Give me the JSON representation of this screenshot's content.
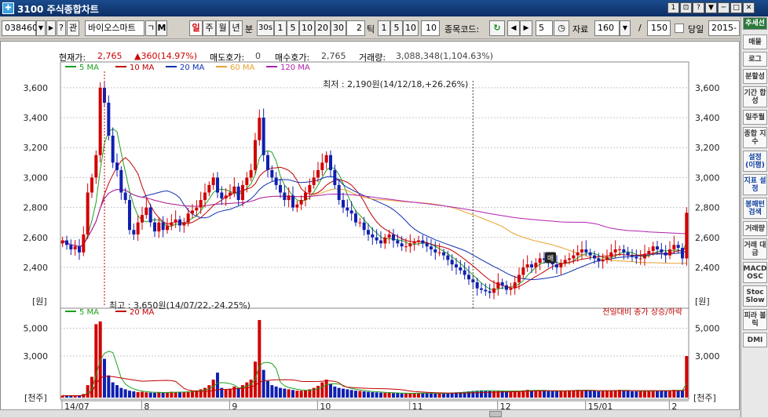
{
  "window": {
    "title": "3100 주식종합차트",
    "controls": [
      "1",
      "⊡",
      "?",
      "▼",
      "─",
      "□",
      "✕"
    ]
  },
  "toolbar": {
    "code": "038460",
    "name": "바이오스마트",
    "name_btn1": "ㄱ",
    "name_btn2": "M",
    "prev_btn": "◀",
    "next_btn": "▶",
    "help_btn": "?",
    "rel_btn": "관",
    "period_day": "일",
    "period_week": "주",
    "period_month": "월",
    "period_year": "년",
    "period_min": "분",
    "min_30s": "30s",
    "min_1": "1",
    "min_5": "5",
    "min_10": "10",
    "min_20": "20",
    "min_30": "30",
    "tick_value": "2",
    "tick_label": "틱",
    "tick_1": "1",
    "tick_5": "5",
    "tick_10": "10",
    "tick_input": "10",
    "stock_code_label": "종목코드:",
    "count_value": "5",
    "data_label": "자료",
    "data_count": "160",
    "slash": "/",
    "total_count": "150",
    "today_label": "당일",
    "date_value": "2015-0"
  },
  "info": {
    "price_label": "현재가:",
    "price": "2,765",
    "change": "▲360(14.97%)",
    "ask_label": "매도호가:",
    "ask": "0",
    "bid_label": "매수호가:",
    "bid": "2,765",
    "volume_label": "거래량:",
    "volume": "3,088,348(1,104.63%)"
  },
  "price_legend": [
    {
      "name": "5 MA",
      "color": "#1ea01e"
    },
    {
      "name": "10 MA",
      "color": "#c00000"
    },
    {
      "name": "20 MA",
      "color": "#1030b0"
    },
    {
      "name": "60 MA",
      "color": "#e8a030"
    },
    {
      "name": "120 MA",
      "color": "#b020b0"
    }
  ],
  "volume_legend": [
    {
      "name": "5 MA",
      "color": "#1ea01e"
    },
    {
      "name": "20 MA",
      "color": "#c00000"
    }
  ],
  "annotations": {
    "low": "최저 : 2,190원(14/12/18,+26.26%)",
    "high": "최고 : 3,650원(14/07/22,-24.25%)",
    "volume_note": "전일대비 종가 상승/하락",
    "price_unit": "[원]",
    "volume_unit": "[천주]",
    "marker": "매"
  },
  "colors": {
    "up": "#d00000",
    "down": "#1020b0",
    "grid": "#c8c8c8"
  },
  "sidebar": {
    "top": "추세선",
    "items": [
      "매물",
      "로그",
      "분할성",
      "기간 합성",
      "일주월",
      "종합 지수",
      "설정 (이평)",
      "지표 설정",
      "봉패턴 검색",
      "거래량",
      "거래 대금",
      "MACD OSC",
      "Stoc Slow",
      "피라 볼릭",
      "DMI"
    ]
  },
  "chart_data": {
    "type": "candlestick",
    "price_ticks": [
      "3,600",
      "3,400",
      "3,200",
      "3,000",
      "2,800",
      "2,600",
      "2,400"
    ],
    "price_tick_values": [
      3600,
      3400,
      3200,
      3000,
      2800,
      2600,
      2400
    ],
    "volume_ticks": [
      "5,000",
      "3,000"
    ],
    "volume_tick_values": [
      5000,
      3000
    ],
    "x_labels": [
      "14/07",
      "8",
      "9",
      "10",
      "11",
      "12",
      "15/01",
      "2"
    ],
    "x_label_index": [
      0,
      19,
      40,
      61,
      83,
      104,
      125,
      145
    ],
    "price_ylim": [
      2190,
      3720
    ],
    "volume_ylim": [
      0,
      6000
    ],
    "closes": [
      2580,
      2550,
      2520,
      2540,
      2500,
      2620,
      2900,
      3000,
      3150,
      3600,
      3500,
      3280,
      3100,
      3050,
      2900,
      2850,
      2650,
      2620,
      2700,
      2750,
      2800,
      2700,
      2640,
      2700,
      2650,
      2680,
      2700,
      2720,
      2680,
      2700,
      2760,
      2780,
      2800,
      2850,
      2900,
      2950,
      3000,
      2900,
      2860,
      2880,
      2900,
      2940,
      2850,
      2950,
      3000,
      3050,
      3250,
      3400,
      3150,
      3050,
      3000,
      2950,
      2900,
      2850,
      2880,
      2800,
      2820,
      2850,
      2900,
      2950,
      3000,
      3050,
      3100,
      3150,
      3050,
      2950,
      2850,
      2800,
      2780,
      2760,
      2700,
      2700,
      2650,
      2620,
      2600,
      2580,
      2560,
      2600,
      2620,
      2580,
      2560,
      2540,
      2540,
      2560,
      2570,
      2580,
      2560,
      2540,
      2520,
      2500,
      2500,
      2480,
      2450,
      2420,
      2400,
      2380,
      2350,
      2320,
      2300,
      2260,
      2250,
      2240,
      2230,
      2260,
      2300,
      2280,
      2250,
      2260,
      2300,
      2350,
      2400,
      2420,
      2400,
      2430,
      2460,
      2450,
      2430,
      2420,
      2400,
      2430,
      2450,
      2460,
      2480,
      2500,
      2520,
      2500,
      2480,
      2460,
      2440,
      2450,
      2470,
      2500,
      2520,
      2520,
      2500,
      2480,
      2470,
      2460,
      2460,
      2490,
      2510,
      2540,
      2520,
      2500,
      2480,
      2520,
      2550,
      2530,
      2460,
      2765
    ],
    "volumes": [
      150,
      120,
      130,
      160,
      140,
      260,
      900,
      1500,
      5300,
      5500,
      2800,
      1600,
      1100,
      900,
      700,
      600,
      500,
      450,
      400,
      420,
      380,
      360,
      350,
      380,
      360,
      400,
      420,
      380,
      420,
      400,
      450,
      500,
      520,
      600,
      700,
      900,
      1300,
      1800,
      700,
      600,
      650,
      800,
      700,
      900,
      1100,
      1300,
      2600,
      5600,
      2000,
      1200,
      900,
      800,
      700,
      650,
      600,
      550,
      500,
      500,
      520,
      600,
      700,
      850,
      1100,
      1300,
      1000,
      800,
      700,
      650,
      600,
      550,
      500,
      480,
      450,
      420,
      400,
      380,
      360,
      350,
      340,
      330,
      320,
      300,
      300,
      320,
      330,
      340,
      320,
      310,
      300,
      290,
      300,
      320,
      340,
      360,
      380,
      400,
      420,
      450,
      480,
      500,
      520,
      500,
      480,
      460,
      470,
      500,
      480,
      470,
      460,
      480,
      520,
      560,
      540,
      520,
      500,
      480,
      470,
      460,
      460,
      480,
      500,
      520,
      540,
      560,
      540,
      520,
      500,
      480,
      460,
      470,
      500,
      520,
      540,
      560,
      500,
      480,
      460,
      450,
      460,
      480,
      500,
      520,
      510,
      500,
      480,
      520,
      560,
      540,
      500,
      3000
    ]
  }
}
